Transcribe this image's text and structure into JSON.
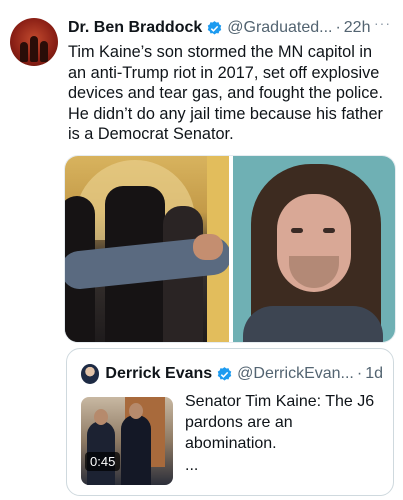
{
  "tweet": {
    "author": {
      "name": "Dr. Ben Braddock",
      "handle": "@Graduated...",
      "separator": "·",
      "time": "22h",
      "more": "···"
    },
    "text": "Tim Kaine’s son stormed the MN capitol in an anti-Trump riot in 2017, set off explosive devices and tear gas, and fought the police. He didn’t do any jail time because his father is a Democrat Senator.",
    "media": [
      "crowd-photo",
      "mugshot-photo"
    ]
  },
  "quote": {
    "author": {
      "name": "Derrick Evans",
      "handle": "@DerrickEvan...",
      "separator": "·",
      "time": "1d"
    },
    "text": "Senator Tim Kaine: The J6 pardons are an abomination.",
    "ellipsis": "...",
    "video_duration": "0:45"
  },
  "colors": {
    "text": "#0f1419",
    "secondary": "#536471",
    "verified": "#1d9bf0",
    "border": "#cfd9de"
  }
}
